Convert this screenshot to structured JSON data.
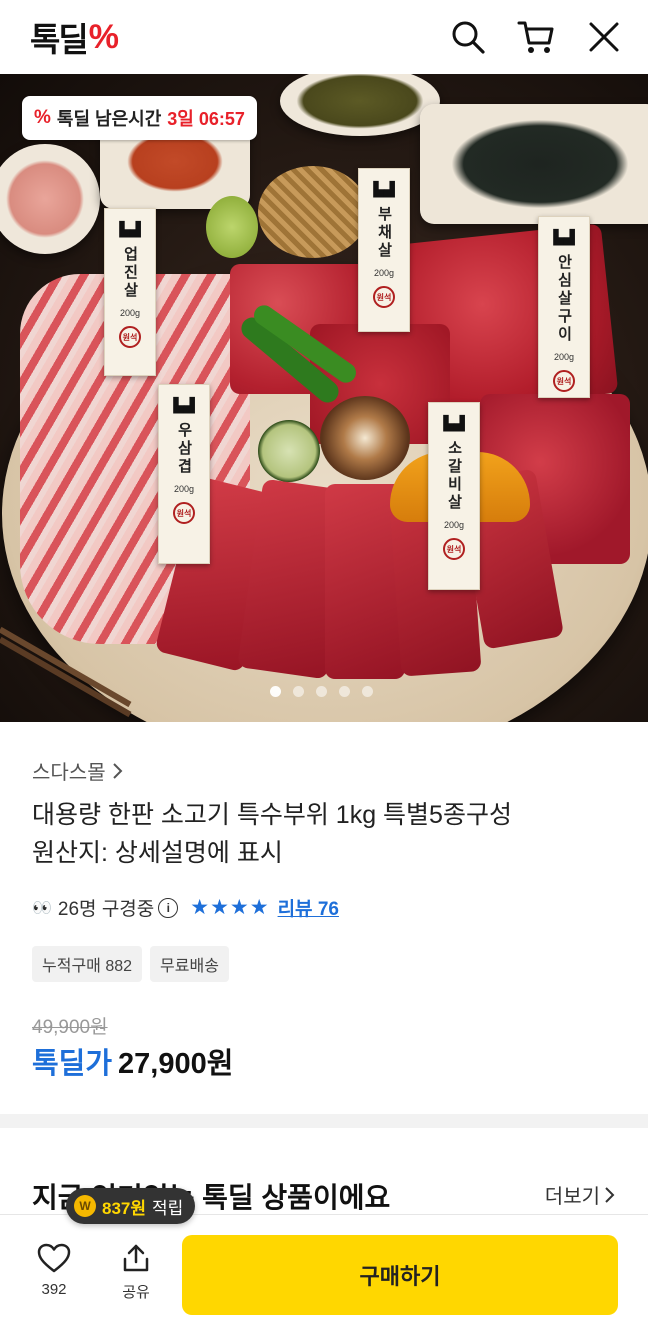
{
  "header": {
    "logo_text": "톡딜",
    "logo_mark": "%",
    "icons": [
      "search-icon",
      "cart-icon",
      "close-icon"
    ]
  },
  "hero": {
    "timer": {
      "label": "톡딜 남은시간",
      "time": "3일 06:57"
    },
    "tags": [
      {
        "name": "업진살",
        "weight": "200g",
        "seal": "원석"
      },
      {
        "name": "부채살",
        "weight": "200g",
        "seal": "원석"
      },
      {
        "name": "안심살구이",
        "weight": "200g",
        "seal": "원석"
      },
      {
        "name": "우삼겹",
        "weight": "200g",
        "seal": "원석"
      },
      {
        "name": "소갈비살",
        "weight": "200g",
        "seal": "원석"
      }
    ],
    "carousel": {
      "count": 5,
      "active_index": 0
    }
  },
  "product": {
    "store": "스다스몰",
    "title_line1": "대용량 한판 소고기 특수부위 1kg 특별5종구성",
    "title_line2": "원산지: 상세설명에 표시",
    "viewers": "26명 구경중",
    "rating_stars": 4,
    "reviews": "리뷰 76",
    "chips": [
      "누적구매 882",
      "무료배송"
    ],
    "original_price": "49,900원",
    "price_label": "톡딜가",
    "price": "27,900원"
  },
  "section": {
    "title": "지금 인기있는 톡딜 상품이에요",
    "more": "더보기"
  },
  "reward": {
    "coin": "W",
    "amount": "837원",
    "label": "적립"
  },
  "bottom_bar": {
    "like_count": "392",
    "share_label": "공유",
    "buy_label": "구매하기"
  },
  "colors": {
    "accent_blue": "#1e6fd9",
    "deal_red": "#e8212a",
    "buy_yellow": "#ffd700"
  }
}
